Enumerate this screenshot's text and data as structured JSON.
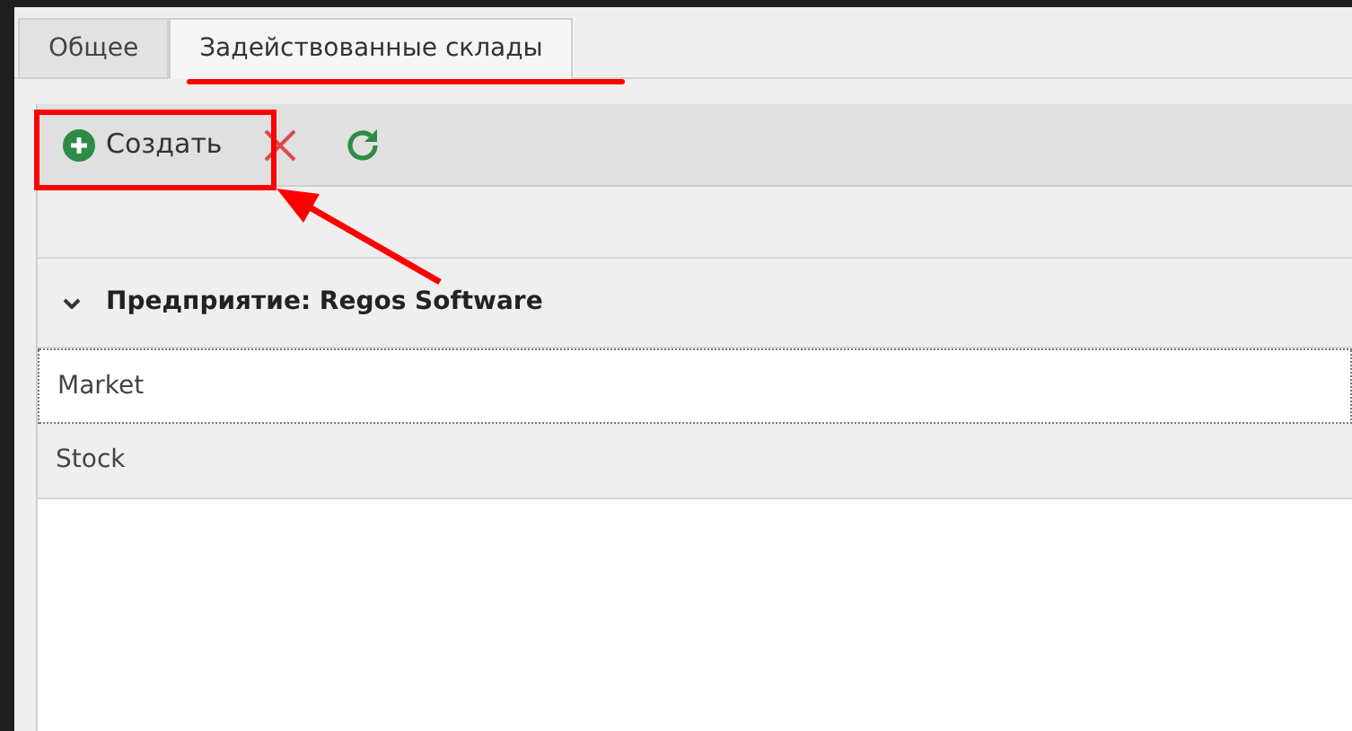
{
  "tabs": [
    {
      "label": "Общее",
      "selected": false
    },
    {
      "label": "Задействованные склады",
      "selected": true
    }
  ],
  "toolbar": {
    "create_button": "Создать"
  },
  "group": {
    "label": "Предприятие: Regos Software",
    "expanded": true
  },
  "rows": [
    {
      "name": "Market",
      "selected": true
    },
    {
      "name": "Stock",
      "selected": false
    }
  ]
}
